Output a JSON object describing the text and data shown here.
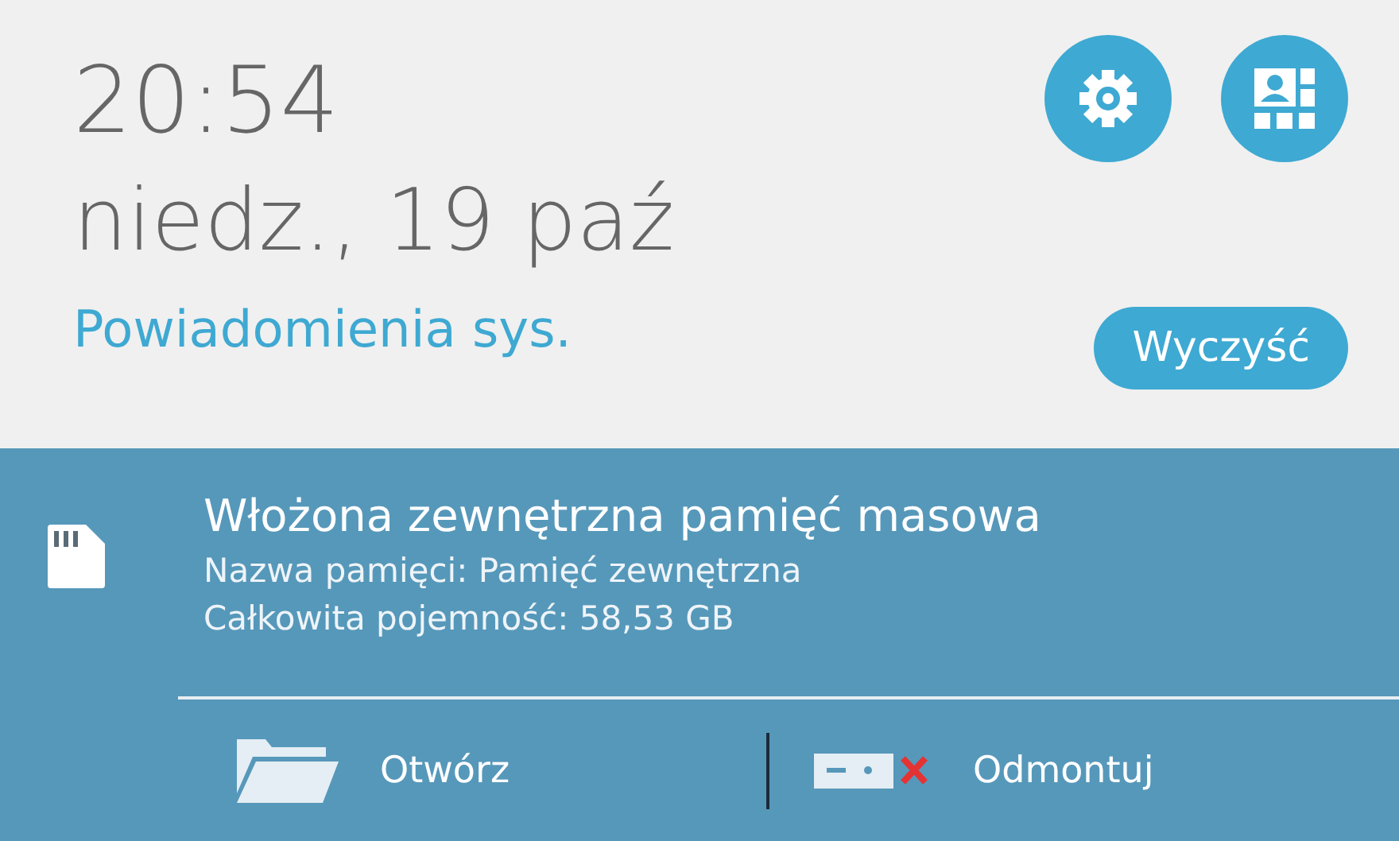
{
  "header": {
    "time": "20:54",
    "date": "niedz., 19 paź",
    "section_label": "Powiadomienia sys.",
    "clear_button": "Wyczyść"
  },
  "notification": {
    "title": "Włożona zewnętrzna pamięć masowa",
    "lines": [
      "Nazwa pamięci: Pamięć zewnętrzna",
      "Całkowita pojemność: 58,53 GB"
    ],
    "actions": [
      {
        "kind": "open",
        "label": "Otwórz"
      },
      {
        "kind": "unmount",
        "label": "Odmontuj"
      }
    ]
  }
}
